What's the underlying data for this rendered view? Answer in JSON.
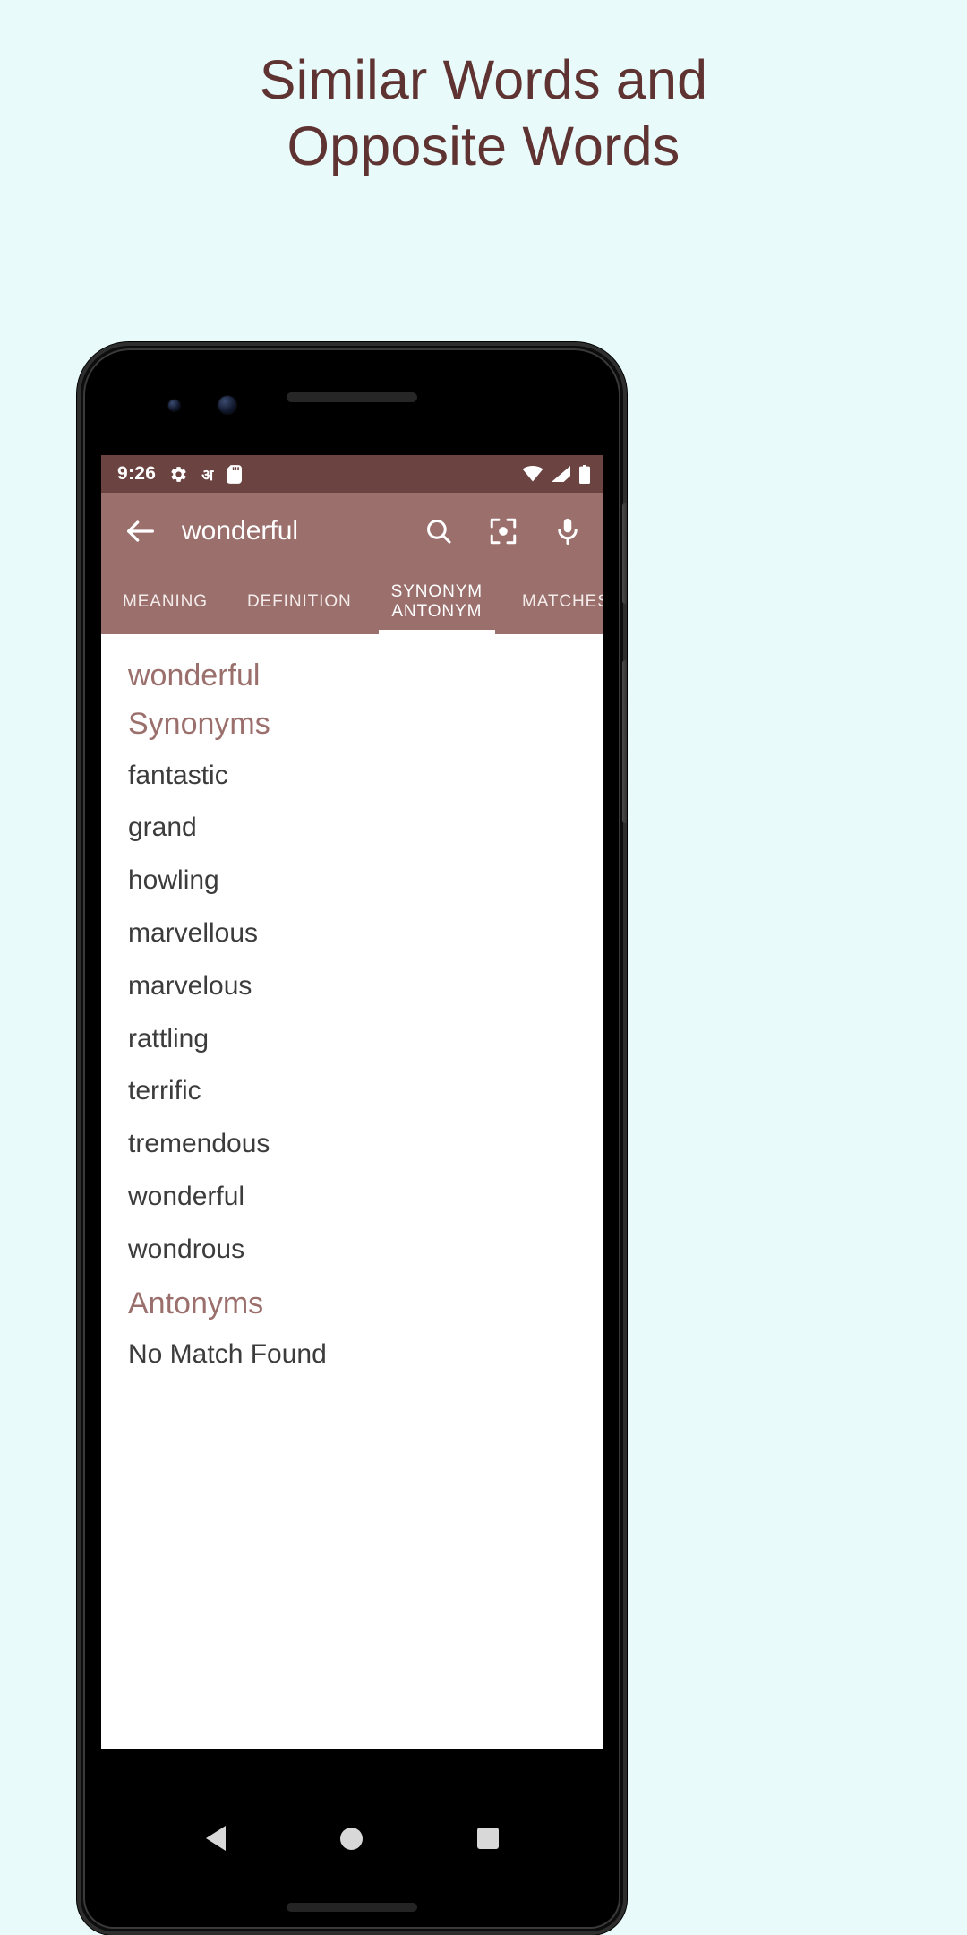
{
  "promo": {
    "title_line1": "Similar Words and",
    "title_line2": "Opposite Words",
    "title_color": "#5f3331",
    "background_color": "#e8fbfa"
  },
  "theme": {
    "status_bar_color": "#6b4442",
    "toolbar_color": "#9a6f6c",
    "accent_color": "#9a6f6c",
    "content_background": "#ffffff",
    "body_text_color": "#3c3c3c"
  },
  "status_bar": {
    "time": "9:26",
    "left_icons": [
      "gear-icon",
      "hindi-language-icon",
      "sd-card-icon"
    ],
    "hindi_glyph": "अ",
    "right_icons": [
      "wifi-icon",
      "cellular-signal-icon",
      "battery-icon"
    ]
  },
  "toolbar": {
    "back_icon": "arrow-back-icon",
    "title": "wonderful",
    "actions": [
      "search-icon",
      "lens-scan-icon",
      "microphone-icon"
    ]
  },
  "tabs": {
    "items": [
      {
        "label": "MEANING",
        "active": false
      },
      {
        "label": "DEFINITION",
        "active": false
      },
      {
        "label": "SYNONYM\nANTONYM",
        "active": true
      },
      {
        "label": "MATCHES",
        "active": false
      }
    ]
  },
  "content": {
    "word_heading": "wonderful",
    "synonyms_label": "Synonyms",
    "synonyms": [
      "fantastic",
      "grand",
      "howling",
      "marvellous",
      "marvelous",
      "rattling",
      "terrific",
      "tremendous",
      "wonderful",
      "wondrous"
    ],
    "antonyms_label": "Antonyms",
    "antonyms_empty_text": "No Match Found"
  },
  "nav_bar": {
    "buttons": [
      "back-triangle-icon",
      "home-circle-icon",
      "recents-square-icon"
    ]
  }
}
